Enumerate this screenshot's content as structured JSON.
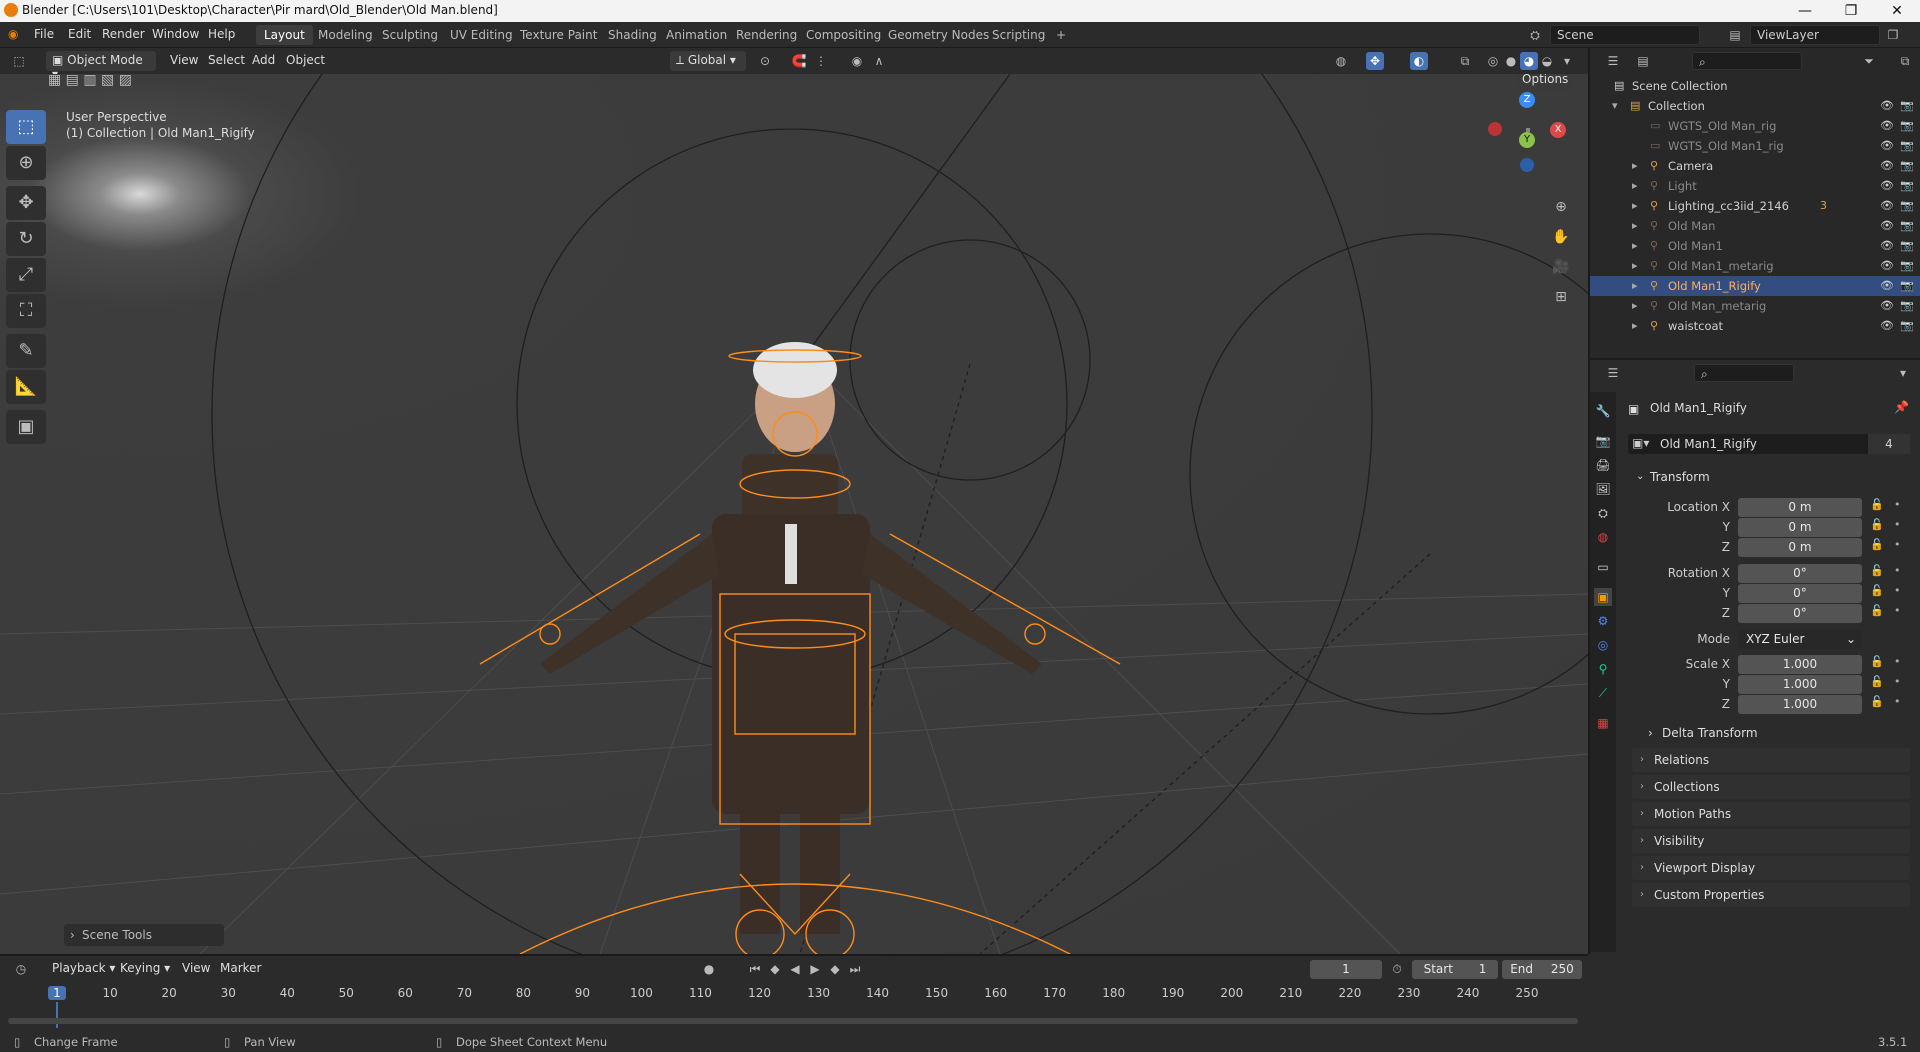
{
  "window": {
    "title": "Blender [C:\\Users\\101\\Desktop\\Character\\Pir mard\\Old_Blender\\Old Man.blend]",
    "minimize": "—",
    "maximize": "❐",
    "close": "✕"
  },
  "menu": [
    "File",
    "Edit",
    "Render",
    "Window",
    "Help"
  ],
  "workspaces": [
    "Layout",
    "Modeling",
    "Sculpting",
    "UV Editing",
    "Texture Paint",
    "Shading",
    "Animation",
    "Rendering",
    "Compositing",
    "Geometry Nodes",
    "Scripting",
    "+"
  ],
  "scene": {
    "name": "Scene",
    "view_layer": "ViewLayer"
  },
  "viewport_header": {
    "mode": "Object Mode",
    "menus": [
      "View",
      "Select",
      "Add",
      "Object"
    ],
    "orientation": "Global",
    "options": "Options"
  },
  "viewport": {
    "perspective": "User Perspective",
    "collection_info": "(1) Collection | Old Man1_Rigify",
    "scene_tools": "Scene Tools",
    "gizmo": {
      "x": "X",
      "y": "Y",
      "z": "Z"
    }
  },
  "outliner": {
    "root": "Scene Collection",
    "items": [
      {
        "label": "Collection",
        "dim": false,
        "selected": false
      },
      {
        "label": "WGTS_Old Man_rig",
        "dim": true,
        "selected": false
      },
      {
        "label": "WGTS_Old Man1_rig",
        "dim": true,
        "selected": false
      },
      {
        "label": "Camera",
        "dim": false,
        "selected": false
      },
      {
        "label": "Light",
        "dim": true,
        "selected": false
      },
      {
        "label": "Lighting_cc3iid_2146",
        "dim": false,
        "selected": false,
        "badge": "3"
      },
      {
        "label": "Old Man",
        "dim": true,
        "selected": false
      },
      {
        "label": "Old Man1",
        "dim": true,
        "selected": false
      },
      {
        "label": "Old Man1_metarig",
        "dim": true,
        "selected": false
      },
      {
        "label": "Old Man1_Rigify",
        "dim": false,
        "selected": true
      },
      {
        "label": "Old Man_metarig",
        "dim": true,
        "selected": false
      },
      {
        "label": "waistcoat",
        "dim": false,
        "selected": false
      }
    ]
  },
  "properties": {
    "object_name": "Old Man1_Rigify",
    "datablock_name": "Old Man1_Rigify",
    "users": "4",
    "transform_title": "Transform",
    "location": {
      "label": "Location X",
      "x": "0 m",
      "y": "0 m",
      "z": "0 m"
    },
    "rotation": {
      "label": "Rotation X",
      "x": "0°",
      "y": "0°",
      "z": "0°"
    },
    "mode": {
      "label": "Mode",
      "value": "XYZ Euler"
    },
    "scale": {
      "label": "Scale X",
      "x": "1.000",
      "y": "1.000",
      "z": "1.000"
    },
    "axis_y": "Y",
    "axis_z": "Z",
    "delta": "Delta Transform",
    "sections": [
      "Relations",
      "Collections",
      "Motion Paths",
      "Visibility",
      "Viewport Display",
      "Custom Properties"
    ]
  },
  "timeline": {
    "menus": [
      "Playback",
      "Keying",
      "View",
      "Marker"
    ],
    "current_frame": "1",
    "start_label": "Start",
    "start": "1",
    "end_label": "End",
    "end": "250",
    "ticks": [
      "1",
      "10",
      "20",
      "30",
      "40",
      "50",
      "60",
      "70",
      "80",
      "90",
      "100",
      "110",
      "120",
      "130",
      "140",
      "150",
      "160",
      "170",
      "180",
      "190",
      "200",
      "210",
      "220",
      "230",
      "240",
      "250"
    ]
  },
  "statusbar": {
    "left": "Change Frame",
    "mid": "Pan View",
    "right": "Dope Sheet Context Menu",
    "version": "3.5.1"
  },
  "colors": {
    "accent": "#4772b3",
    "selection_orange": "#ff8c1a",
    "x_axis": "#e04848",
    "y_axis": "#8bc34a",
    "z_axis": "#3a8ef0"
  }
}
